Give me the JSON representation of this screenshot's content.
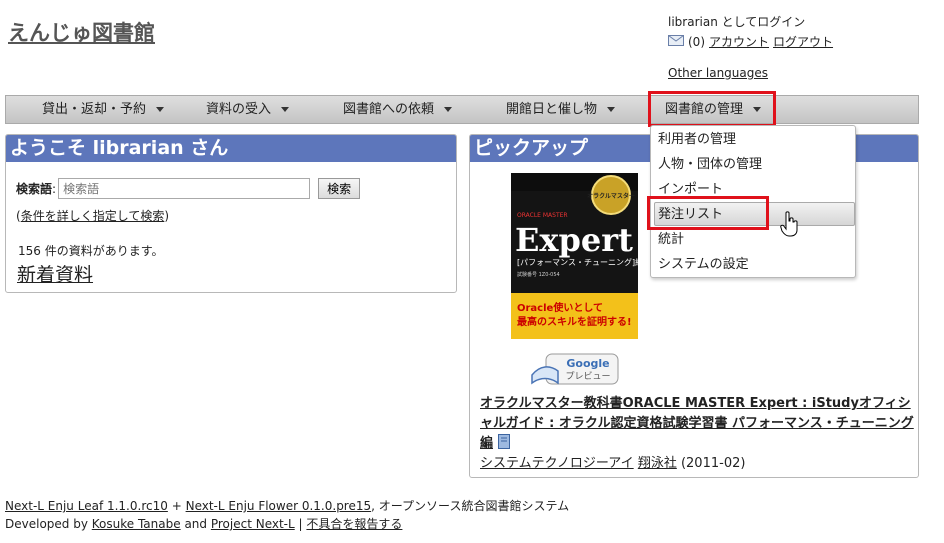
{
  "site": {
    "title": "えんじゅ図書館"
  },
  "user": {
    "login_text": "librarian としてログイン",
    "mail_count": "(0)",
    "account_link": "アカウント",
    "logout_link": "ログアウト",
    "other_languages": "Other languages"
  },
  "nav": {
    "items": [
      {
        "label": "貸出・返却・予約"
      },
      {
        "label": "資料の受入"
      },
      {
        "label": "図書館への依頼"
      },
      {
        "label": "開館日と催し物"
      },
      {
        "label": "図書館の管理"
      }
    ]
  },
  "dropdown": {
    "items": [
      {
        "label": "利用者の管理"
      },
      {
        "label": "人物・団体の管理"
      },
      {
        "label": "インポート"
      },
      {
        "label": "発注リスト"
      },
      {
        "label": "統計"
      },
      {
        "label": "システムの設定"
      }
    ]
  },
  "welcome": {
    "title": "ようこそ librarian さん",
    "search_label": "検索語",
    "search_colon": ":",
    "search_placeholder": "検索語",
    "search_button": "検索",
    "advanced_prefix": "(",
    "advanced_link": "条件を詳しく指定して検索",
    "advanced_suffix": ")",
    "count_text": "156 件の資料があります。",
    "new_books": "新着資料"
  },
  "pickup": {
    "title": "ピックアップ",
    "book_title": "オラクルマスター教科書ORACLE MASTER Expert : iStudyオフィシャルガイド : オラクル認定資格試験学習書 パフォーマンス・チューニング編",
    "publisher": "システムテクノロジーアイ",
    "author": "翔泳社",
    "date": "(2011-02)",
    "cover": {
      "badge": "オラクルマスター",
      "series": "ORACLE MASTER",
      "main": "Expert",
      "sub": "[パフォーマンス・チューニング]編",
      "exam": "試験番号 1Z0-054",
      "headline1": "Oracle使いとして",
      "headline2": "最高のスキルを証明する!"
    },
    "preview_label1": "Google",
    "preview_label2": "プレビュー"
  },
  "footer": {
    "leaf": "Next-L Enju Leaf 1.1.0.rc10",
    "plus": "+",
    "flower": "Next-L Enju Flower 0.1.0.pre15",
    "tagline": ", オープンソース統合図書館システム",
    "developed_by": "Developed by",
    "dev1": "Kosuke Tanabe",
    "and": "and",
    "dev2": "Project Next-L",
    "sep": "|",
    "report": "不具合を報告する"
  },
  "colors": {
    "panel_header": "#5d76bb",
    "highlight_box": "#e0111b"
  }
}
